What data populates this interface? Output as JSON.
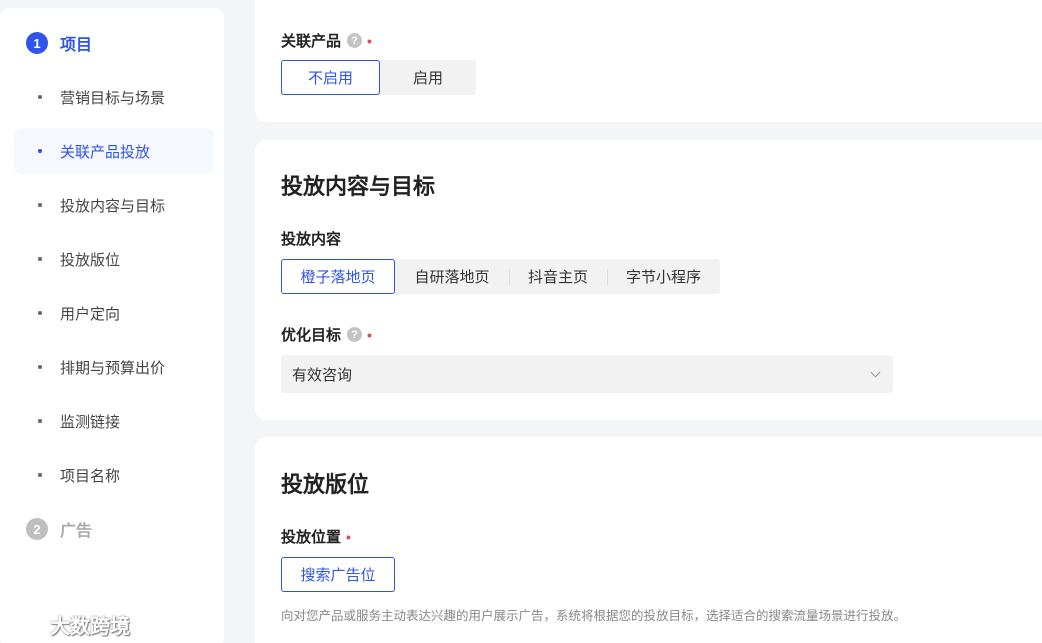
{
  "steps": [
    {
      "num": "1",
      "label": "项目"
    },
    {
      "num": "2",
      "label": "广告"
    }
  ],
  "nav_items": [
    {
      "label": "营销目标与场景"
    },
    {
      "label": "关联产品投放"
    },
    {
      "label": "投放内容与目标"
    },
    {
      "label": "投放版位"
    },
    {
      "label": "用户定向"
    },
    {
      "label": "排期与预算出价"
    },
    {
      "label": "监测链接"
    },
    {
      "label": "项目名称"
    }
  ],
  "product": {
    "label": "关联产品",
    "help": "?",
    "required_mark": "•",
    "options": [
      "不启用",
      "启用"
    ]
  },
  "content_section": {
    "title": "投放内容与目标",
    "content_label": "投放内容",
    "content_options": [
      "橙子落地页",
      "自研落地页",
      "抖音主页",
      "字节小程序"
    ],
    "goal_label": "优化目标",
    "goal_help": "?",
    "goal_required": "•",
    "goal_value": "有效咨询"
  },
  "placement_section": {
    "title": "投放版位",
    "position_label": "投放位置",
    "position_required": "•",
    "position_option": "搜索广告位",
    "description": "向对您产品或服务主动表达兴趣的用户展示广告，系统将根据您的投放目标，选择适合的搜索流量场景进行投放。"
  },
  "watermark": "大数跨境",
  "colors": {
    "accent": "#2f54eb",
    "required": "#e5484d"
  }
}
